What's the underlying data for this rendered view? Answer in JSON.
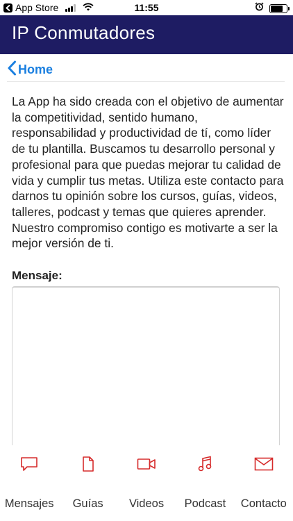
{
  "status_bar": {
    "back_app": "App Store",
    "time": "11:55"
  },
  "header": {
    "title": "IP Conmutadores"
  },
  "nav": {
    "back_label": "Home"
  },
  "intro_text": "La App ha sido creada con el objetivo de aumentar la competitividad, sentido humano, responsabilidad y productividad de tí, como líder de tu plantilla. Buscamos tu desarrollo personal y profesional para que puedas mejorar tu calidad de vida y cumplir tus metas. Utiliza este contacto para darnos tu opinión sobre los cursos, guías, videos, talleres, podcast y temas que quieres aprender. Nuestro compromiso contigo es motivarte a ser la mejor versión de ti.",
  "form": {
    "message_label": "Mensaje:",
    "message_value": ""
  },
  "tabs": [
    {
      "label": "Mensajes",
      "icon": "chat-bubble-icon"
    },
    {
      "label": "Guías",
      "icon": "document-icon"
    },
    {
      "label": "Videos",
      "icon": "video-camera-icon"
    },
    {
      "label": "Podcast",
      "icon": "music-note-icon"
    },
    {
      "label": "Contacto",
      "icon": "mail-icon"
    }
  ],
  "colors": {
    "header_bg": "#1e1c63",
    "link": "#1a7fe0",
    "tab_icon": "#d62b2b"
  }
}
